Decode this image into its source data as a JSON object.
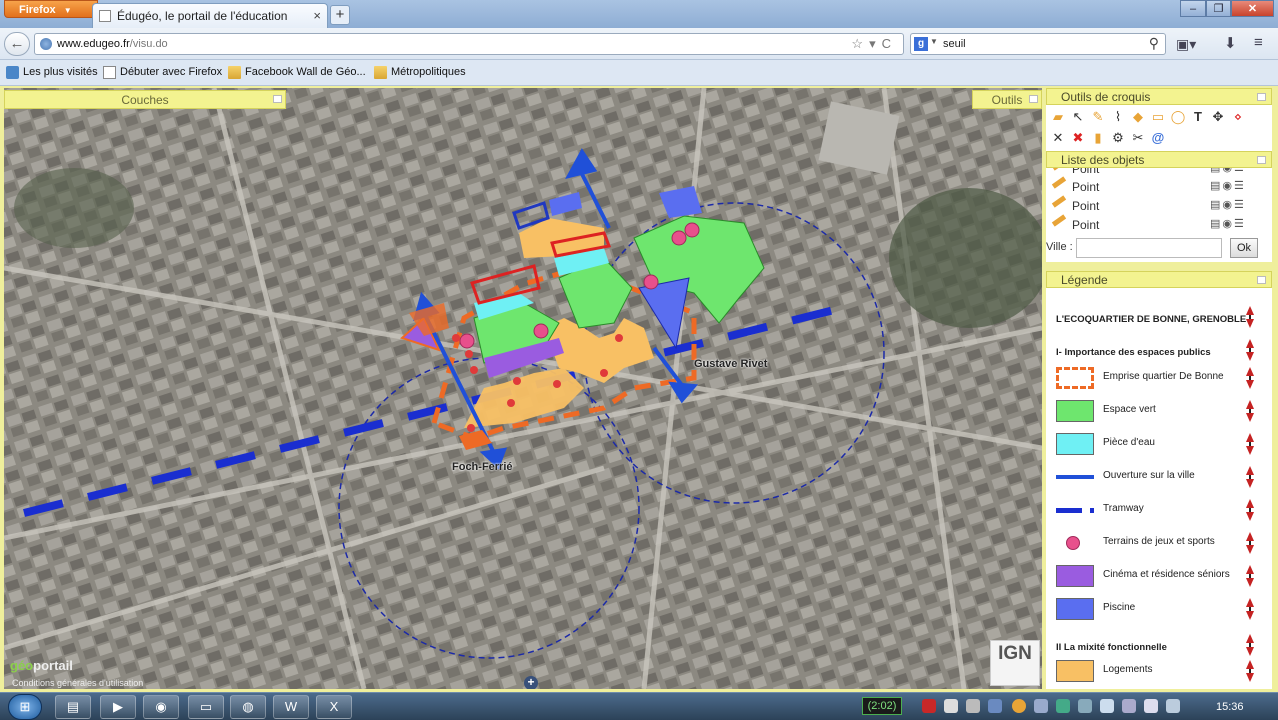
{
  "browser": {
    "app_button": "Firefox",
    "tab_title": "Édugéo, le portail de l'éducation",
    "url_host": "www.edugeo.fr",
    "url_path": "/visu.do",
    "search_value": "seuil",
    "bookmarks": [
      {
        "label": "Les plus visités",
        "icon": "star-icon"
      },
      {
        "label": "Débuter avec Firefox",
        "icon": "page-icon"
      },
      {
        "label": "Facebook Wall de Géo...",
        "icon": "folder-icon"
      },
      {
        "label": "Métropolitiques",
        "icon": "folder-icon"
      }
    ]
  },
  "map": {
    "couches_tab": "Couches",
    "outils_tab": "Outils",
    "labels": {
      "gustave": "Gustave Rivet",
      "foch": "Foch-Ferrié"
    },
    "logo_geo": "géo",
    "logo_portail": "portail",
    "conditions": "Conditions générales d'utilisation",
    "ign": "IGN"
  },
  "sidebar": {
    "croquis_title": "Outils de croquis",
    "objets_title": "Liste des objets",
    "objects": [
      "Point",
      "Point",
      "Point",
      "Point"
    ],
    "ville_label": "Ville :",
    "ville_value": "",
    "ok_label": "Ok",
    "legende_title": "Légende",
    "legend": {
      "main_title": "L'ECOQUARTIER DE BONNE, GRENOBLE",
      "section1": "I- Importance des espaces publics",
      "items1": [
        {
          "label": "Emprise quartier De Bonne",
          "kind": "dash-rect",
          "color": "#ee6a25"
        },
        {
          "label": "Espace vert",
          "kind": "fill",
          "color": "#6ee66e"
        },
        {
          "label": "Pièce d'eau",
          "kind": "fill",
          "color": "#6ff0f4"
        },
        {
          "label": "Ouverture sur la ville",
          "kind": "line",
          "color": "#2050d8"
        },
        {
          "label": "Tramway",
          "kind": "dash-line",
          "color": "#1a2ed0"
        },
        {
          "label": "Terrains de jeux et sports",
          "kind": "circle",
          "color": "#e8508c"
        },
        {
          "label": "Cinéma et résidence séniors",
          "kind": "fill",
          "color": "#9a5ce0"
        },
        {
          "label": "Piscine",
          "kind": "fill",
          "color": "#5a6ef0"
        }
      ],
      "section2": "II La mixité fonctionnelle",
      "items2": [
        {
          "label": "Logements",
          "kind": "fill",
          "color": "#f8c064"
        }
      ]
    }
  },
  "taskbar": {
    "timer": "(2:02)",
    "clock": "15:36"
  },
  "colors": {
    "panel_yellow": "#f3f390",
    "frame_yellow": "#efef9c",
    "emprise_orange": "#ee6a25",
    "tram_blue": "#1a2ed0"
  }
}
